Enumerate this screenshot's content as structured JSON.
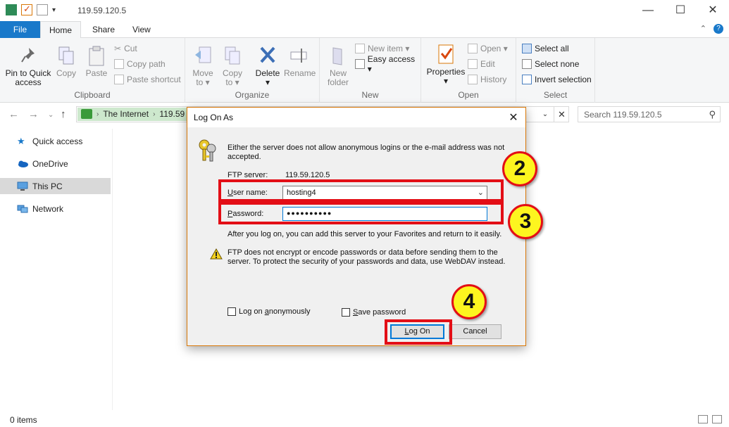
{
  "window": {
    "title": "119.59.120.5",
    "minimize_glyph": "—",
    "maximize_glyph": "☐",
    "close_glyph": "✕"
  },
  "tabs": {
    "file": "File",
    "home": "Home",
    "share": "Share",
    "view": "View"
  },
  "ribbon": {
    "clipboard": {
      "label": "Clipboard",
      "pin": "Pin to Quick",
      "pin2": "access",
      "copy": "Copy",
      "paste": "Paste",
      "cut": "Cut",
      "copy_path": "Copy path",
      "paste_shortcut": "Paste shortcut"
    },
    "organize": {
      "label": "Organize",
      "move": "Move",
      "move2": "to ▾",
      "copy": "Copy",
      "copy2": "to ▾",
      "delete": "Delete",
      "delete2": "▾",
      "rename": "Rename"
    },
    "new": {
      "label": "New",
      "new_folder": "New",
      "new_folder2": "folder",
      "new_item": "New item ▾",
      "easy_access": "Easy access ▾"
    },
    "open": {
      "label": "Open",
      "properties": "Properties",
      "properties2": "▾",
      "open": "Open ▾",
      "edit": "Edit",
      "history": "History"
    },
    "select": {
      "label": "Select",
      "select_all": "Select all",
      "select_none": "Select none",
      "invert": "Invert selection"
    }
  },
  "address": {
    "crumbs": [
      "The Internet",
      "119.59"
    ],
    "search_placeholder": "Search 119.59.120.5"
  },
  "navpane": {
    "items": [
      "Quick access",
      "OneDrive",
      "This PC",
      "Network"
    ]
  },
  "status": {
    "items": "0 items"
  },
  "dialog": {
    "title": "Log On As",
    "message": "Either the server does not allow anonymous logins or the e-mail address was not accepted.",
    "ftp_label": "FTP server:",
    "ftp_value": "119.59.120.5",
    "username_label_u": "U",
    "username_label_rest": "ser name:",
    "username_value": "hosting4",
    "password_label_u": "P",
    "password_label_rest": "assword:",
    "password_value": "●●●●●●●●●●",
    "after_text": "After you log on, you can add this server to your Favorites and return to it easily.",
    "warning_text": "FTP does not encrypt or encode passwords or data before sending them to the server.  To protect the security of your passwords and data, use WebDAV instead.",
    "anon_label_pre": "Log on ",
    "anon_label_u": "a",
    "anon_label_rest": "nonymously",
    "save_label_u": "S",
    "save_label_rest": "ave password",
    "logon_button_u": "L",
    "logon_button_rest": "og On",
    "cancel_button": "Cancel"
  },
  "callouts": [
    "2",
    "3",
    "4"
  ],
  "colors": {
    "accent": "#1979ca",
    "highlight": "#e30e16",
    "badge": "#fdf51f"
  }
}
